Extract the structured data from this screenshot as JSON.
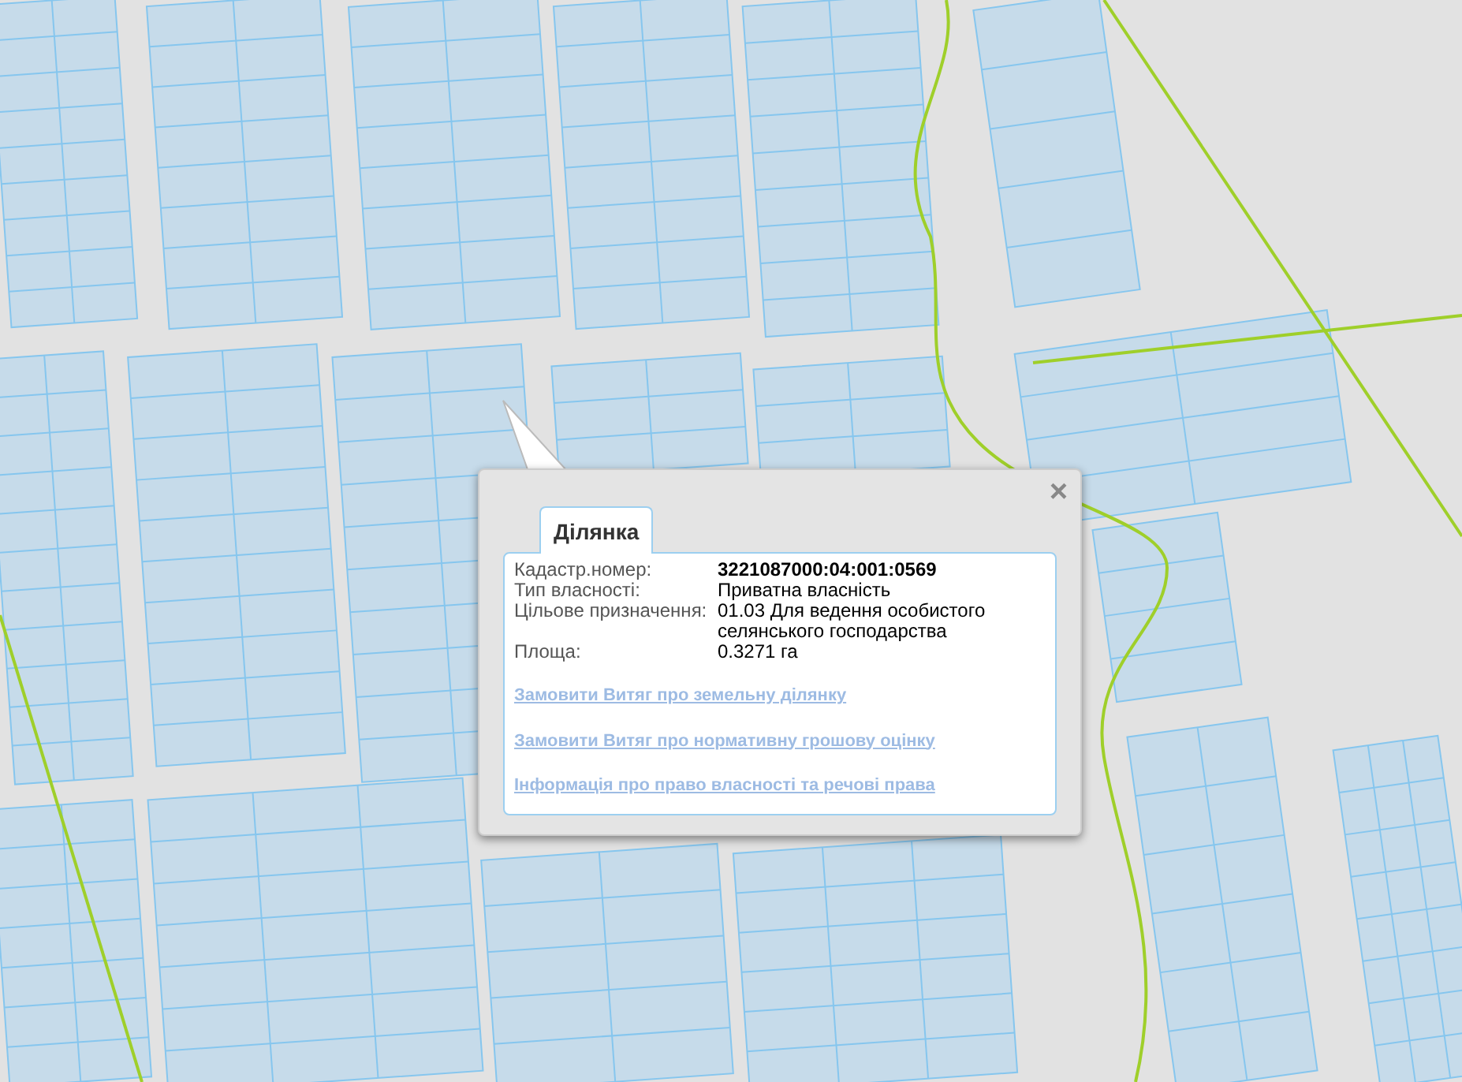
{
  "popup": {
    "tab": {
      "label": "Ділянка",
      "selected": true
    },
    "fields": [
      {
        "label": "Кадастр.номер:",
        "value": "3221087000:04:001:0569",
        "kind": "bold"
      },
      {
        "label": "Тип власності:",
        "value": "Приватна власність",
        "kind": "plain"
      },
      {
        "label": "Цільове призначення:",
        "value": "01.03 Для ведення особистого селянського господарства",
        "kind": "plain"
      },
      {
        "label": "Площа:",
        "value": "0.3271 га",
        "kind": "plain"
      }
    ],
    "links": [
      "Замовити Витяг про земельну ділянку",
      "Замовити Витяг про нормативну грошову оцінку",
      "Інформація про право власності та речові права"
    ],
    "close": "×"
  }
}
